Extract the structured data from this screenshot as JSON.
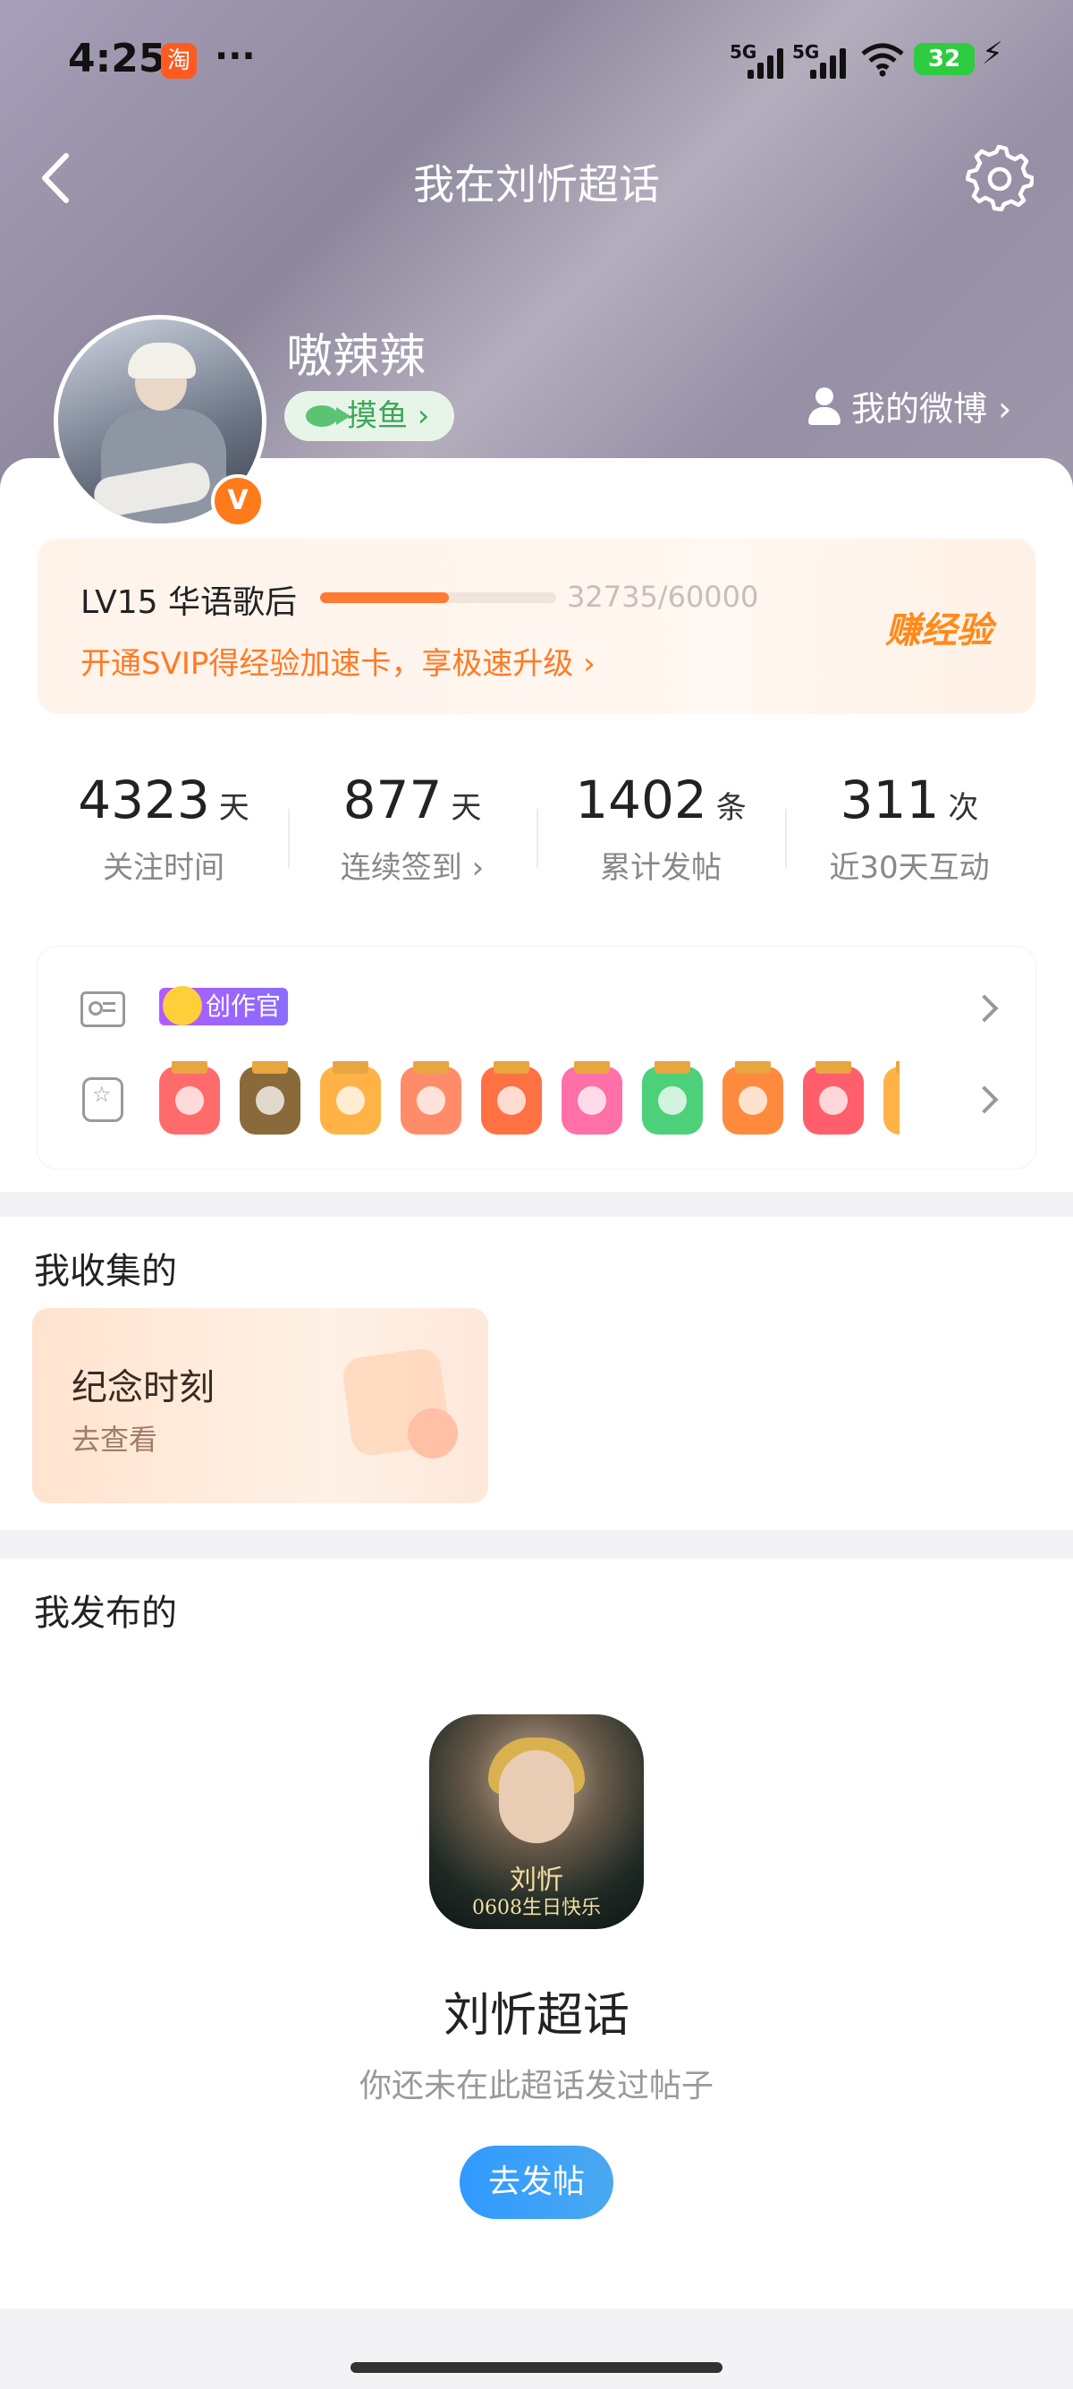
{
  "status": {
    "time": "4:25",
    "taobao": "淘",
    "dots": "···",
    "net1": "5G",
    "net2": "5G",
    "battery": "32"
  },
  "nav": {
    "title": "我在刘忻超话"
  },
  "profile": {
    "username": "嗷辣辣",
    "fish_badge": "摸鱼 ›",
    "my_weibo": "我的微博 ›",
    "v_badge": "V"
  },
  "level": {
    "label": "LV15 华语歌后",
    "current": 32735,
    "max": 60000,
    "progress_text": "32735/60000",
    "svip_text": "开通SVIP得经验加速卡，享极速升级 ›",
    "earn": "赚经验"
  },
  "stats": [
    {
      "num": "4323",
      "unit": "天",
      "label": "关注时间"
    },
    {
      "num": "877",
      "unit": "天",
      "label": "连续签到 ›"
    },
    {
      "num": "1402",
      "unit": "条",
      "label": "累计发帖"
    },
    {
      "num": "311",
      "unit": "次",
      "label": "近30天互动"
    }
  ],
  "badges": {
    "creator": "创作官",
    "medals": [
      "#ff6b6b",
      "#8a6a3a",
      "#ffb347",
      "#ff8c69",
      "#ff7043",
      "#ff6fa8",
      "#4cd07a",
      "#ff8a3d",
      "#ff5f6d",
      "#ffb347"
    ]
  },
  "collected": {
    "title": "我收集的",
    "card_title": "纪念时刻",
    "card_sub": "去查看"
  },
  "posted": {
    "title": "我发布的",
    "topic_name": "刘忻超话",
    "hint": "你还未在此超话发过帖子",
    "button": "去发帖",
    "cover_name": "刘忻",
    "cover_caption": "0608生日快乐"
  }
}
